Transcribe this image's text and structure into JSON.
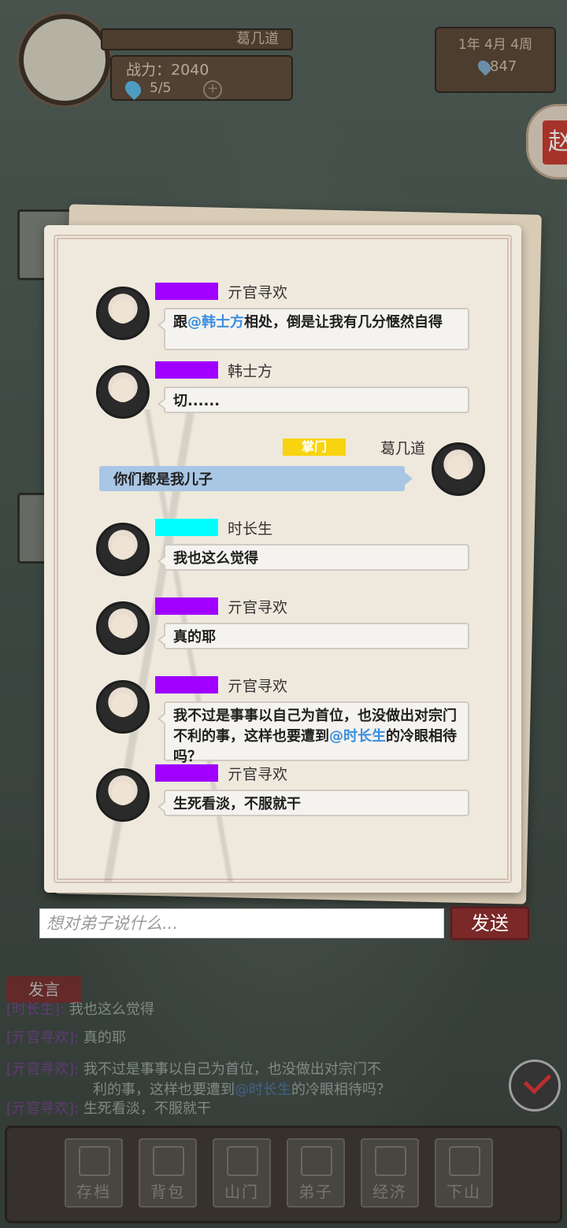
{
  "hud": {
    "player_name": "葛几道",
    "power": "战力：2040",
    "energy": "5/5",
    "date": "1年  4月  4周",
    "gems": "847"
  },
  "chat": {
    "messages": [
      {
        "name": "亓官寻欢",
        "badge_color": "#a000ff",
        "text_before": "跟",
        "mention": "@韩士方",
        "text_after": "相处，倒是让我有几分惬然自得"
      },
      {
        "name": "韩士方",
        "badge_color": "#a000ff",
        "text": "切......"
      },
      {
        "name": "时长生",
        "badge_color": "#00ffff",
        "text": "我也这么觉得"
      },
      {
        "name": "亓官寻欢",
        "badge_color": "#a000ff",
        "text": "真的耶"
      },
      {
        "name": "亓官寻欢",
        "badge_color": "#a000ff",
        "text_before": "我不过是事事以自己为首位，也没做出对宗门不利的事，这样也要遭到",
        "mention": "@时长生",
        "text_after": "的冷眼相待吗？"
      },
      {
        "name": "亓官寻欢",
        "badge_color": "#a000ff",
        "text": "生死看淡，不服就干"
      }
    ],
    "self_message": {
      "name": "葛几道",
      "title": "掌门",
      "text": "你们都是我儿子"
    }
  },
  "input": {
    "placeholder": "想对弟子说什么...",
    "send_label": "发送"
  },
  "log": {
    "speak_label": "发言",
    "lines": [
      {
        "name": "[时长生]:",
        "text": "我也这么觉得"
      },
      {
        "name": "[亓官寻欢]:",
        "text": "真的耶"
      },
      {
        "name": "[亓官寻欢]:",
        "text_before": "我不过是事事以自己为首位，也没做出对宗门不",
        "text_line2": "利的事，这样也要遭到",
        "mention": "@时长生",
        "text_after": "的冷眼相待吗？"
      },
      {
        "name": "[亓官寻欢]:",
        "text": "生死看淡，不服就干"
      }
    ]
  },
  "nav": {
    "items": [
      {
        "label": "存档",
        "icon": "book-icon"
      },
      {
        "label": "背包",
        "icon": "bag-icon"
      },
      {
        "label": "山门",
        "icon": "gate-icon"
      },
      {
        "label": "弟子",
        "icon": "disciple-icon"
      },
      {
        "label": "经济",
        "icon": "economy-icon"
      },
      {
        "label": "下山",
        "icon": "mountain-icon"
      }
    ]
  },
  "colors": {
    "accent_send": "#7a2828",
    "mention": "#3b8ee0",
    "leader_badge": "#f7d40f",
    "self_bubble": "#a9c6e4"
  }
}
